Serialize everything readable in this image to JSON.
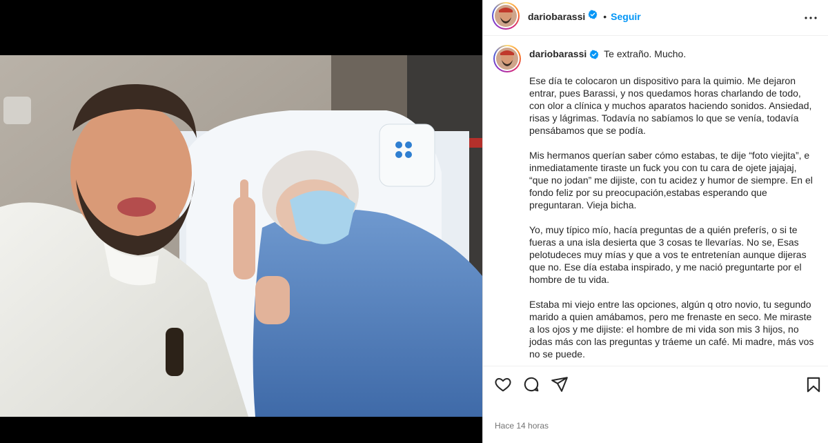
{
  "post": {
    "username": "dariobarassi",
    "follow_label": "Seguir",
    "separator": "•",
    "caption_first_line": "Te extraño. Mucho.",
    "paragraphs": [
      "Ese día te colocaron un dispositivo para la quimio. Me dejaron entrar, pues Barassi, y nos quedamos horas charlando de todo, con olor a clínica y muchos aparatos haciendo sonidos. Ansiedad, risas y lágrimas. Todavía no sabíamos lo que se venía, todavía pensábamos que se podía.",
      "Mis hermanos querían saber cómo estabas, te dije “foto viejita”, e inmediatamente tiraste un fuck you con tu cara de ojete jajajaj, “que no jodan” me dijiste, con tu acidez y humor de siempre. En el fondo feliz por su preocupación,estabas esperando que preguntaran. Vieja bicha.",
      "Yo, muy típico mío, hacía preguntas de a quién preferís, o si te fueras a una isla desierta que 3 cosas te llevarías. No se, Esas pelotudeces muy mías y que a vos te entretenían aunque dijeras que no. Ese día estaba inspirado, y me nació preguntarte por el hombre de tu vida.",
      "Estaba mi viejo entre las opciones, algún q otro novio, tu segundo marido a quien amábamos, pero me frenaste en seco. Me miraste a los ojos y me dijiste: el hombre de mi vida son mis 3 hijos, no jodas más con las preguntas y tráeme un café. Mi madre, más vos no se puede."
    ],
    "timestamp": "Hace 14 horas"
  },
  "icons": {
    "like": "heart-icon",
    "comment": "comment-icon",
    "share": "send-icon",
    "save": "bookmark-icon",
    "more": "more-icon",
    "verified": "verified-badge-icon"
  },
  "colors": {
    "accent": "#0095f6",
    "verified": "#0095f6",
    "muted": "#737373"
  }
}
